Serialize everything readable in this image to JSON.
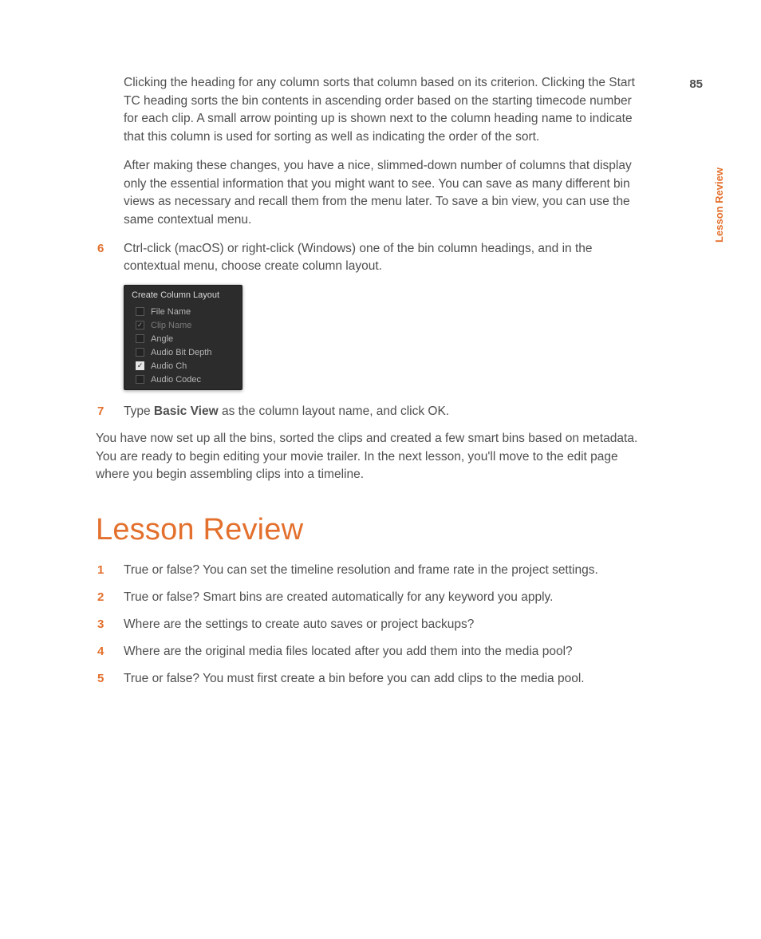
{
  "page_number": "85",
  "side_label": "Lesson Review",
  "paragraphs": {
    "p1": "Clicking the heading for any column sorts that column based on its criterion. Clicking the Start TC heading sorts the bin contents in ascending order based on the starting timecode number for each clip. A small arrow pointing up is shown next to the column heading name to indicate that this column is used for sorting as well as indicating the order of the sort.",
    "p2": "After making these changes, you have a nice, slimmed-down number of columns that display only the essential information that you might want to see. You can save as many different bin views as necessary and recall them from the menu later. To save a bin view, you can use the same contextual menu.",
    "closing": "You have now set up all the bins, sorted the clips and created a few smart bins based on metadata. You are ready to begin editing your movie trailer. In the next lesson, you'll move to the edit page where you begin assembling clips into a timeline."
  },
  "steps": {
    "s6": {
      "num": "6",
      "text": "Ctrl-click (macOS) or right-click (Windows) one of the bin column headings, and in the contextual menu, choose create column layout."
    },
    "s7": {
      "num": "7",
      "prefix": "Type ",
      "bold": "Basic View",
      "suffix": " as the column layout name, and click OK."
    }
  },
  "ctx_menu": {
    "header": "Create Column Layout",
    "items": [
      {
        "label": "File Name",
        "checked": false,
        "disabled": false
      },
      {
        "label": "Clip Name",
        "checked": true,
        "disabled": true
      },
      {
        "label": "Angle",
        "checked": false,
        "disabled": false
      },
      {
        "label": "Audio Bit Depth",
        "checked": false,
        "disabled": false
      },
      {
        "label": "Audio Ch",
        "checked": true,
        "disabled": false
      },
      {
        "label": "Audio Codec",
        "checked": false,
        "disabled": false
      }
    ]
  },
  "heading": "Lesson Review",
  "review": [
    {
      "num": "1",
      "text": "True or false? You can set the timeline resolution and frame rate in the project settings."
    },
    {
      "num": "2",
      "text": "True or false? Smart bins are created automatically for any keyword you apply."
    },
    {
      "num": "3",
      "text": "Where are the settings to create auto saves or project backups?"
    },
    {
      "num": "4",
      "text": "Where are the original media files located after you add them into the media pool?"
    },
    {
      "num": "5",
      "text": "True or false? You must first create a bin before you can add clips to the media pool."
    }
  ]
}
